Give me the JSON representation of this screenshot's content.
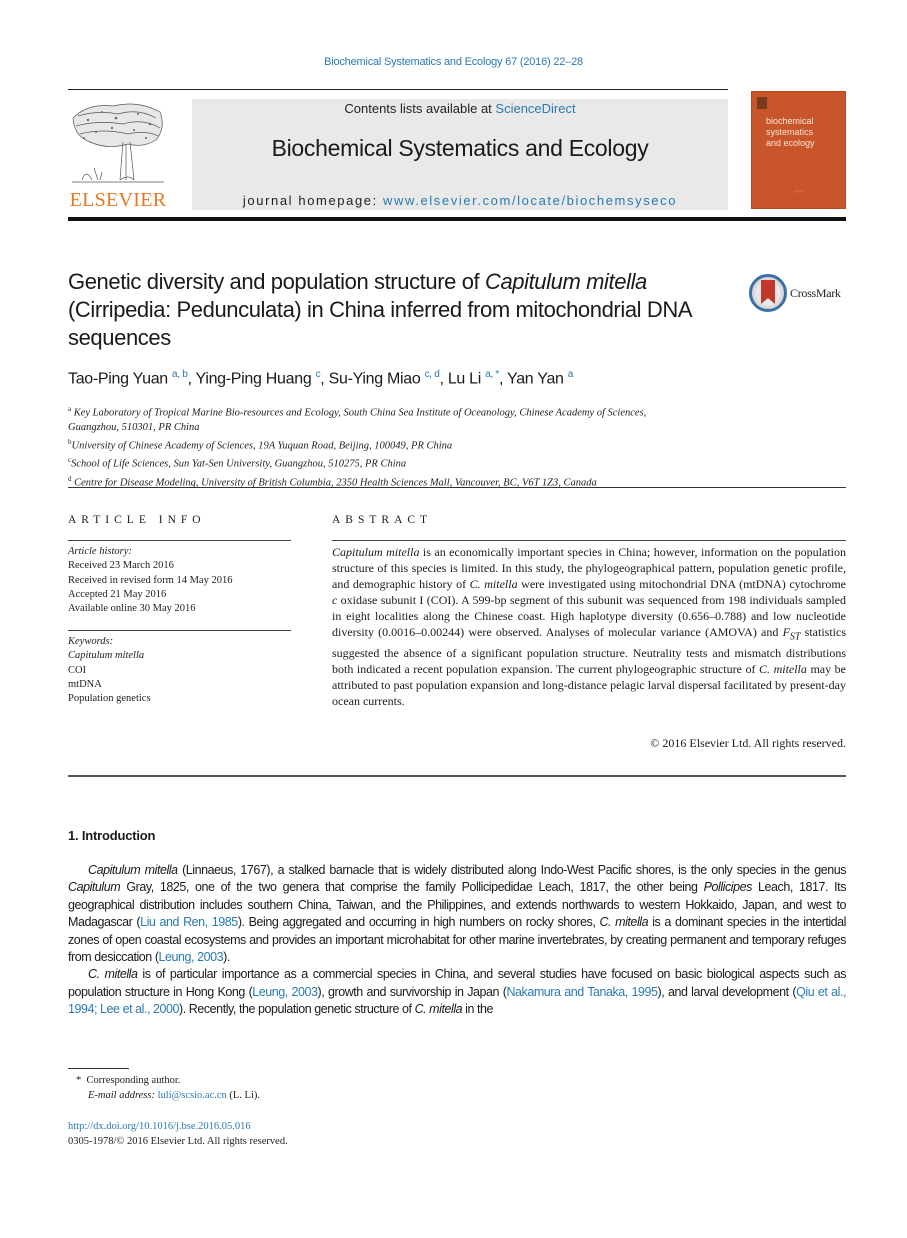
{
  "journal_reference": "Biochemical Systematics and Ecology 67 (2016) 22–28",
  "header": {
    "publisher_logo_text": "ELSEVIER",
    "contents_prefix": "Contents lists available at ",
    "contents_link": "ScienceDirect",
    "journal_name": "Biochemical Systematics and Ecology",
    "homepage_prefix": "journal homepage: ",
    "homepage_link": "www.elsevier.com/locate/biochemsyseco",
    "cover_title_lines": [
      "biochemical",
      "systematics",
      "and ecology"
    ]
  },
  "colors": {
    "link": "#2a7ab0",
    "elsevier_orange": "#e87722",
    "cover": "#c9552a",
    "header_box": "#e9e9e9"
  },
  "article": {
    "title_part1": "Genetic diversity and population structure of ",
    "title_italic1": "Capitulum",
    "title_italic2": "mitella",
    "title_part2": " (Cirripedia: Pedunculata) in China inferred from mitochondrial DNA sequences",
    "crossmark_label": "CrossMark",
    "authors": [
      {
        "name": "Tao-Ping Yuan",
        "sup": "a, b"
      },
      {
        "name": "Ying-Ping Huang",
        "sup": "c"
      },
      {
        "name": "Su-Ying Miao",
        "sup": "c, d"
      },
      {
        "name": "Lu Li",
        "sup": "a, *"
      },
      {
        "name": "Yan Yan",
        "sup": "a"
      }
    ],
    "affiliations": [
      {
        "key": "a",
        "line1": "Key Laboratory of Tropical Marine Bio-resources and Ecology, South China Sea Institute of Oceanology, Chinese Academy of Sciences,",
        "line2": "Guangzhou, 510301, PR China"
      },
      {
        "key": "b",
        "line1": "University of Chinese Academy of Sciences, 19A Yuquan Road, Beijing, 100049, PR China"
      },
      {
        "key": "c",
        "line1": "School of Life Sciences, Sun Yat-Sen University, Guangzhou, 510275, PR China"
      },
      {
        "key": "d",
        "line1": "Centre for Disease Modeling, University of British Columbia, 2350 Health Sciences Mall, Vancouver, BC, V6T 1Z3, Canada"
      }
    ]
  },
  "article_info": {
    "heading": "ARTICLE INFO",
    "history_label": "Article history:",
    "history": [
      "Received 23 March 2016",
      "Received in revised form 14 May 2016",
      "Accepted 21 May 2016",
      "Available online 30 May 2016"
    ],
    "keywords_label": "Keywords:",
    "keywords": [
      "Capitulum mitella",
      "COI",
      "mtDNA",
      "Population genetics"
    ]
  },
  "abstract": {
    "heading": "ABSTRACT",
    "s1_italic": "Capitulum mitella",
    "s1": " is an economically important species in China; however, information on the population structure of this species is limited. In this study, the phylogeo­graphical pattern, population genetic profile, and demographic history of ",
    "s2_italic": "C. mitella",
    "s2": " were investigated using mitochondrial DNA (mtDNA) cytochrome ",
    "s3_italic": "c",
    "s3": " oxidase subunit I (COI). A 599-bp segment of this subunit was sequenced from 198 individuals sampled in eight localities along the Chinese coast. High haplotype diversity (0.656–0.788) and low nucleotide diversity (0.0016–0.00244) were observed. Analyses of molecular variance (AMOVA) and ",
    "fst_F": "F",
    "fst_sub": "ST",
    "s4": " statistics suggested the absence of a significant population structure. Neutrality tests and mismatch distributions both indicated a recent population expan­sion. The current phylogeographic structure of ",
    "s5_italic": "C. mitella",
    "s5": " may be attributed to past population expansion and long-distance pelagic larval dispersal facilitated by present-day ocean currents.",
    "copyright": "© 2016 Elsevier Ltd. All rights reserved."
  },
  "introduction": {
    "heading": "1.  Introduction",
    "p1": {
      "i1": "Capitulum mitella",
      "t1": " (Linnaeus, 1767), a stalked barnacle that is widely distributed along Indo-West Pacific shores, is the only species in the genus ",
      "i2": "Capitulum",
      "t2": " Gray, 1825, one of the two genera that comprise the family Pollicipedidae Leach, 1817, the other being ",
      "i3": "Pollicipes",
      "t3": " Leach, 1817. Its geographical distribution includes southern China, Taiwan, and the Philippines, and extends northwards to western Hokkaido, Japan, and west to Madagascar (",
      "ref1": "Liu and Ren, 1985",
      "t4": "). Being aggregated and occurring in high numbers on rocky shores, ",
      "i4": "C. mitella",
      "t5": " is a dominant species in the intertidal zones of open coastal ecosystems and provides an important microhabitat for other marine invertebrates, by creating permanent and temporary refuges from desiccation (",
      "ref2": "Leung, 2003",
      "t6": ")."
    },
    "p2": {
      "i1": "C. mitella",
      "t1": " is of particular importance as a commercial species in China, and several studies have focused on basic biological aspects such as population structure in Hong Kong (",
      "ref1": "Leung, 2003",
      "t2": "), growth and survivorship in Japan (",
      "ref2": "Nakamura and Tanaka, 1995",
      "t3": "), and larval development (",
      "ref3": "Qiu et al., 1994; Lee et al., 2000",
      "t4": "). Recently, the population genetic structure of ",
      "i2": "C. mitella",
      "t5": " in the"
    }
  },
  "footnotes": {
    "corresponding_mark": "*",
    "corresponding": "Corresponding author.",
    "email_label": "E-mail address:",
    "email": "luli@scsio.ac.cn",
    "email_suffix": " (L. Li).",
    "doi": "http://dx.doi.org/10.1016/j.bse.2016.05.016",
    "issn_line": "0305-1978/© 2016 Elsevier Ltd. All rights reserved."
  }
}
